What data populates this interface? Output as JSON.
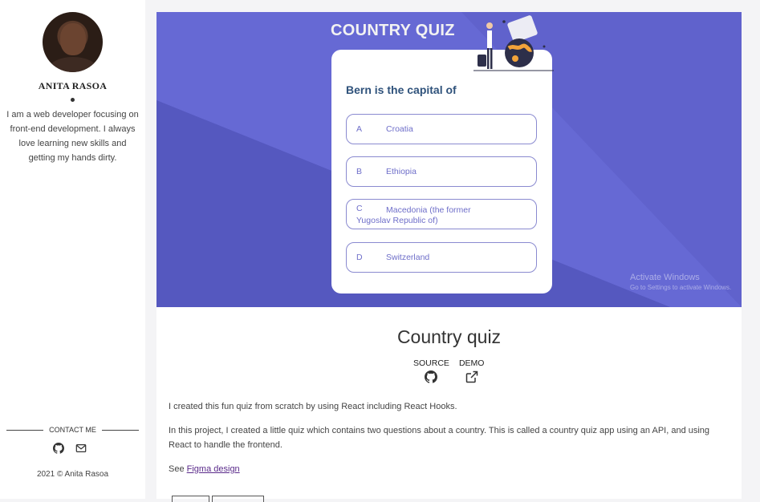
{
  "sidebar": {
    "name": "ANITA RASOA",
    "bio": "I am a web developer focusing on front-end development. I always love learning new skills and getting my hands dirty.",
    "contact_label": "CONTACT ME",
    "contact_icons": [
      "github-icon",
      "mail-icon"
    ],
    "copyright": "2021 © Anita Rasoa"
  },
  "hero": {
    "quiz_title": "COUNTRY QUIZ",
    "question": "Bern is the capital of",
    "options": [
      {
        "key": "A",
        "value": "Croatia"
      },
      {
        "key": "B",
        "value": "Ethiopia"
      },
      {
        "key": "C",
        "value": "Macedonia (the former",
        "value2": "Yugoslav Republic of)"
      },
      {
        "key": "D",
        "value": "Switzerland"
      }
    ],
    "watermark_line1": "Activate Windows",
    "watermark_line2": "Go to Settings to activate Windows."
  },
  "project": {
    "title": "Country quiz",
    "source_label": "SOURCE",
    "demo_label": "DEMO",
    "para1": "I created this fun quiz from scratch by using React including React Hooks.",
    "para2": "In this project, I created a little quiz which contains two questions about a country. This is called a country quiz app using an API, and using React to handle the frontend.",
    "see_prefix": "See ",
    "figma_link": "Figma design"
  },
  "colors": {
    "hero_bg": "#5c5fc7",
    "question": "#2f527b",
    "option_text": "#6e6ec9",
    "link": "#5a2a8a"
  }
}
